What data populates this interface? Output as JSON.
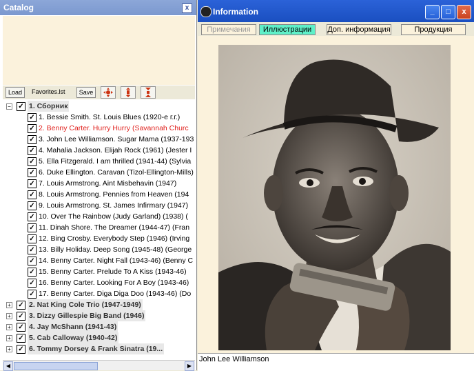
{
  "catalog": {
    "title": "Catalog",
    "close_glyph": "x",
    "toolbar": {
      "load_label": "Load",
      "file_label": "Favorites.lst",
      "save_label": "Save"
    },
    "tree": [
      {
        "label": "1. Сборник",
        "expanded": true,
        "checked": true,
        "items": [
          {
            "label": "1. Bessie Smith. St. Louis Blues (1920-е г.г.)",
            "checked": true
          },
          {
            "label": "2. Benny Carter. Hurry Hurry (Savannah Churc",
            "checked": true,
            "selected": true
          },
          {
            "label": "3. John Lee Williamson. Sugar Mama (1937-193",
            "checked": true
          },
          {
            "label": "4. Mahalia Jackson. Elijah Rock (1961) (Jester I",
            "checked": true
          },
          {
            "label": "5. Ella Fitzgerald. I am thrilled (1941-44) (Sylvia",
            "checked": true
          },
          {
            "label": "6. Duke Ellington. Caravan (Tizol-Ellington-Mills)",
            "checked": true
          },
          {
            "label": "7. Louis Armstrong. Aint Misbehavin (1947)",
            "checked": true
          },
          {
            "label": "8. Louis Armstrong. Pennies from Heaven (194",
            "checked": true
          },
          {
            "label": "9. Louis Armstrong. St. James Infirmary (1947)",
            "checked": true
          },
          {
            "label": "10. Over The Rainbow (Judy Garland) (1938) (",
            "checked": true
          },
          {
            "label": "11. Dinah Shore. The Dreamer (1944-47) (Fran",
            "checked": true
          },
          {
            "label": "12. Bing Crosby. Everybody Step (1946) (Irving",
            "checked": true
          },
          {
            "label": "13. Billy Holiday. Deep Song (1945-48) (George",
            "checked": true
          },
          {
            "label": "14. Benny Carter. Night Fall (1943-46) (Benny C",
            "checked": true
          },
          {
            "label": "15. Benny Carter. Prelude To A Kiss (1943-46)",
            "checked": true
          },
          {
            "label": "16. Benny Carter. Looking For A Boy (1943-46)",
            "checked": true
          },
          {
            "label": "17. Benny Carter. Diga Diga Doo (1943-46) (Do",
            "checked": true
          }
        ]
      },
      {
        "label": "2. Nat King Cole Trio (1947-1949)",
        "expanded": false,
        "checked": true
      },
      {
        "label": "3. Dizzy Gillespie Big Band (1946)",
        "expanded": false,
        "checked": true
      },
      {
        "label": "4. Jay McShann (1941-43)",
        "expanded": false,
        "checked": true
      },
      {
        "label": "5. Cab Calloway (1940-42)",
        "expanded": false,
        "checked": true
      },
      {
        "label": "6. Tommy Dorsey & Frank Sinatra (19...",
        "expanded": false,
        "checked": true
      }
    ]
  },
  "information": {
    "title": "Information",
    "window_buttons": {
      "minimize": "_",
      "maximize": "□",
      "close": "x"
    },
    "tabs": [
      {
        "label": "Примечания",
        "state": "disabled"
      },
      {
        "label": "Иллюстрации",
        "state": "active"
      },
      {
        "label": "Доп. информация",
        "state": "normal"
      },
      {
        "label": "Продукция",
        "state": "normal"
      }
    ],
    "caption": "John Lee Williamson"
  },
  "colors": {
    "catalog_titlebar": "#7b98cf",
    "info_titlebar": "#1a4fc0",
    "selected_text": "#e0201c",
    "active_tab": "#5ff0c8",
    "panel_bg": "#fbf2dc"
  }
}
